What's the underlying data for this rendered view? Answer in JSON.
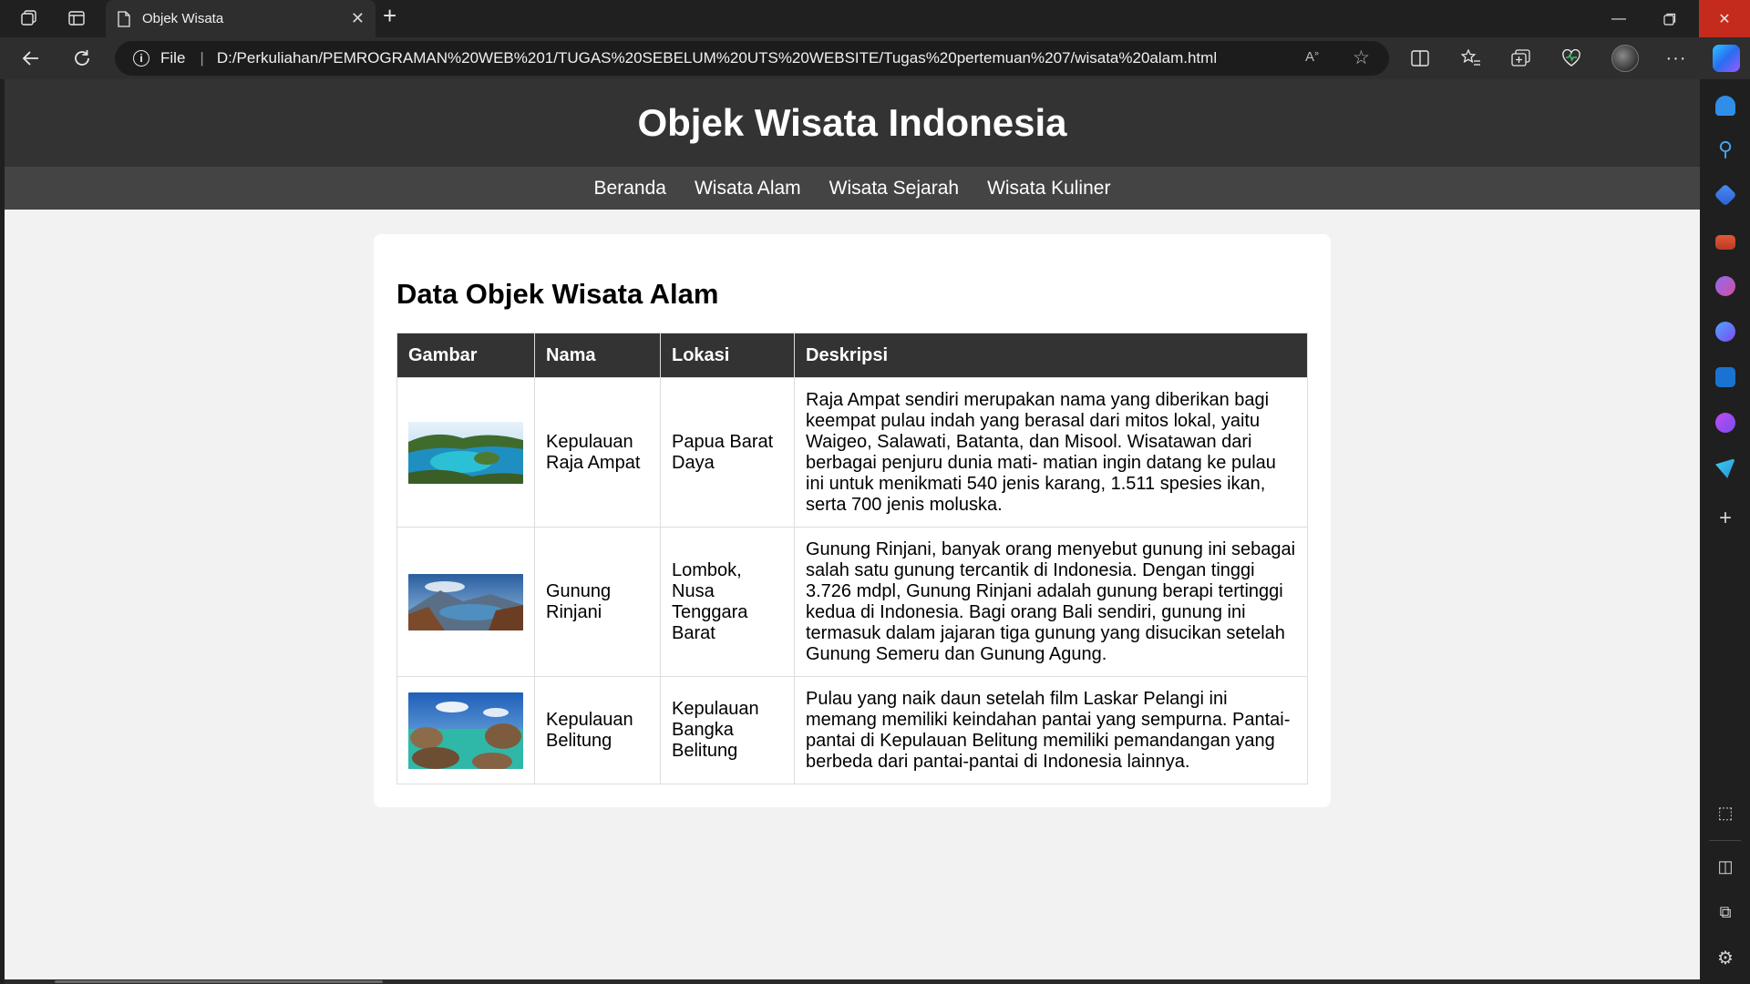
{
  "browser": {
    "tab_title": "Objek Wisata",
    "address": {
      "scheme_label": "File",
      "url": "D:/Perkuliahan/PEMROGRAMAN%20WEB%201/TUGAS%20SEBELUM%20UTS%20WEBSITE/Tugas%20pertemuan%207/wisata%20alam.html"
    },
    "icons": [
      "workspaces-icon",
      "tab-actions-icon",
      "page-icon",
      "close-tab-icon",
      "new-tab-icon",
      "minimize-icon",
      "restore-icon",
      "close-window-icon",
      "back-icon",
      "refresh-icon",
      "info-icon",
      "read-aloud-icon",
      "favorite-star-icon",
      "split-screen-icon",
      "favorites-icon",
      "collections-icon",
      "browser-essentials-icon",
      "profile-avatar",
      "more-icon",
      "copilot-icon"
    ]
  },
  "sidebar": {
    "icons": [
      "notification-icon",
      "search-icon",
      "shopping-icon",
      "tools-icon",
      "games-icon",
      "copilot-app-icon",
      "outlook-icon",
      "designer-icon",
      "send-icon",
      "add-icon",
      "screenshot-icon",
      "sidebar-toggle-icon",
      "open-external-icon",
      "settings-icon"
    ]
  },
  "site": {
    "title": "Objek Wisata Indonesia",
    "nav": [
      "Beranda",
      "Wisata Alam",
      "Wisata Sejarah",
      "Wisata Kuliner"
    ],
    "section_title": "Data Objek Wisata Alam",
    "table": {
      "headers": [
        "Gambar",
        "Nama",
        "Lokasi",
        "Deskripsi"
      ],
      "rows": [
        {
          "image": "raja-ampat-photo",
          "nama": "Kepulauan Raja Ampat",
          "lokasi": "Papua Barat Daya",
          "deskripsi": "Raja Ampat sendiri merupakan nama yang diberikan bagi keempat pulau indah yang berasal dari mitos lokal, yaitu Waigeo, Salawati, Batanta, dan Misool. Wisatawan dari berbagai penjuru dunia mati- matian ingin datang ke pulau ini untuk menikmati 540 jenis karang, 1.511 spesies ikan, serta 700 jenis moluska."
        },
        {
          "image": "gunung-rinjani-photo",
          "nama": "Gunung Rinjani",
          "lokasi": "Lombok, Nusa Tenggara Barat",
          "deskripsi": "Gunung Rinjani, banyak orang menyebut gunung ini sebagai salah satu gunung tercantik di Indonesia. Dengan tinggi 3.726 mdpl, Gunung Rinjani adalah gunung berapi tertinggi kedua di Indonesia. Bagi orang Bali sendiri, gunung ini termasuk dalam jajaran tiga gunung yang disucikan setelah Gunung Semeru dan Gunung Agung."
        },
        {
          "image": "belitung-photo",
          "nama": "Kepulauan Belitung",
          "lokasi": "Kepulauan Bangka Belitung",
          "deskripsi": "Pulau yang naik daun setelah film Laskar Pelangi ini memang memiliki keindahan pantai yang sempurna. Pantai-pantai di Kepulauan Belitung memiliki pemandangan yang berbeda dari pantai-pantai di Indonesia lainnya."
        }
      ]
    }
  },
  "colors": {
    "header_bg": "#333333",
    "nav_bg": "#444444",
    "page_bg": "#f2f2f2",
    "card_bg": "#ffffff",
    "browser_bg": "#202020"
  }
}
